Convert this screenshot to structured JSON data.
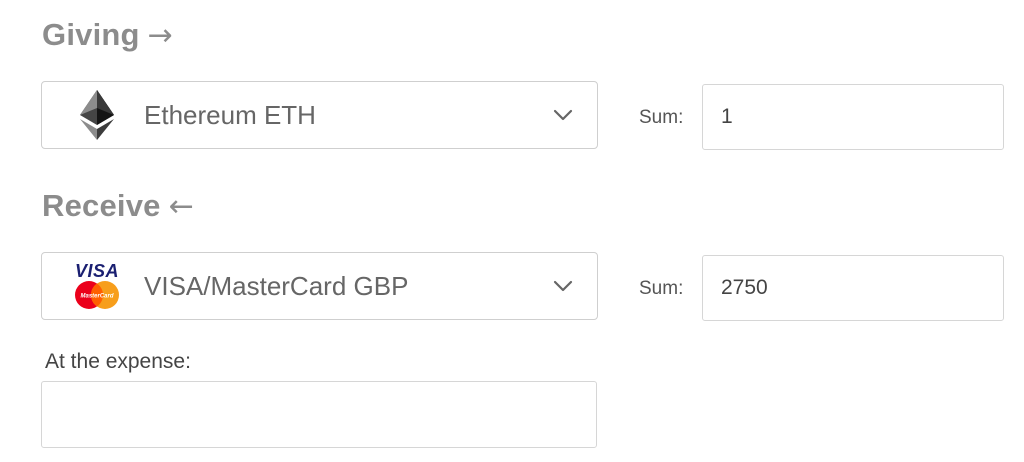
{
  "giving": {
    "title": "Giving",
    "arrow": "→",
    "currency": {
      "label": "Ethereum ETH",
      "icon": "ethereum-icon"
    },
    "sum_label": "Sum:",
    "sum_value": "1"
  },
  "receive": {
    "title": "Receive",
    "arrow": "←",
    "currency": {
      "label": "VISA/MasterCard GBP",
      "icon": "visa-mastercard-icon",
      "logo_text": "VISA",
      "mastercard_text": "MasterCard"
    },
    "sum_label": "Sum:",
    "sum_value": "2750"
  },
  "expense": {
    "label": "At the expense:",
    "value": ""
  },
  "colors": {
    "title": "#8c8c8c",
    "border": "#cfcfcf",
    "visa_blue": "#1a1f71",
    "mastercard_red": "#eb001b",
    "mastercard_yellow": "#f79e1b"
  }
}
